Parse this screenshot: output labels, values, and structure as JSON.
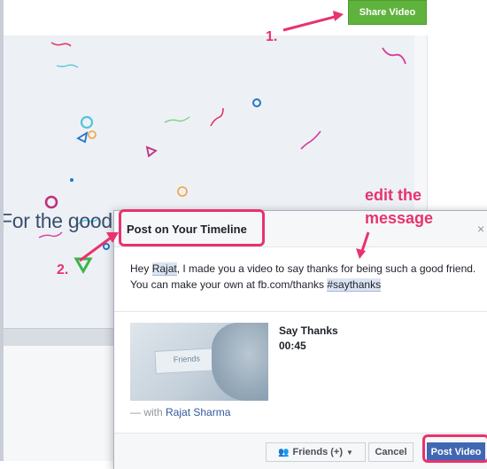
{
  "share_button": {
    "label": "Share Video"
  },
  "video": {
    "caption": "For the good times we’ve had"
  },
  "dialog": {
    "title": "Post on Your Timeline",
    "close_icon": "close-icon",
    "message": {
      "part1": "Hey ",
      "tag_name": "Rajat",
      "part2": ", I made you a video to say thanks for being such a good friend. You can make your own at fb.com/thanks ",
      "hashtag": "#saythanks"
    },
    "attachment": {
      "thumbnail_label": "Friends",
      "title": "Say Thanks",
      "duration": "00:45"
    },
    "with_prefix": "— with ",
    "with_name": "Rajat Sharma",
    "footer": {
      "audience_label": "Friends (+)",
      "cancel_label": "Cancel",
      "post_label": "Post Video"
    }
  },
  "annotations": {
    "step1": "1.",
    "step2": "2.",
    "edit_note_line1": "edit the",
    "edit_note_line2": "message",
    "accent_color": "#e8336d"
  }
}
